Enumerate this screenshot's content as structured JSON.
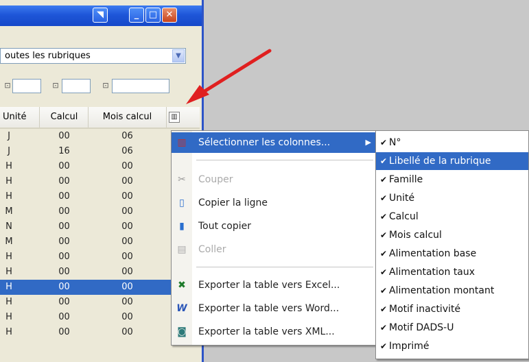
{
  "filter": {
    "value": "outes les rubriques"
  },
  "grid": {
    "headers": [
      "Unité",
      "Calcul",
      "Mois calcul"
    ],
    "rows": [
      [
        "J",
        "00",
        "06"
      ],
      [
        "J",
        "16",
        "06"
      ],
      [
        "H",
        "00",
        "00"
      ],
      [
        "H",
        "00",
        "00"
      ],
      [
        "H",
        "00",
        "00"
      ],
      [
        "M",
        "00",
        "00"
      ],
      [
        "N",
        "00",
        "00"
      ],
      [
        "M",
        "00",
        "00"
      ],
      [
        "H",
        "00",
        "00"
      ],
      [
        "H",
        "00",
        "00"
      ],
      [
        "H",
        "00",
        "00"
      ],
      [
        "H",
        "00",
        "00"
      ],
      [
        "H",
        "00",
        "00"
      ],
      [
        "H",
        "00",
        "00"
      ]
    ],
    "selected_row_index": 10
  },
  "context_menu": {
    "items": [
      {
        "label": "Sélectionner les colonnes...",
        "icon": "columns-icon",
        "enabled": true,
        "submenu": true
      },
      {
        "label": "Couper",
        "icon": "scissors-icon",
        "enabled": false
      },
      {
        "label": "Copier la ligne",
        "icon": "copy-row-icon",
        "enabled": true
      },
      {
        "label": "Tout copier",
        "icon": "copy-all-icon",
        "enabled": true
      },
      {
        "label": "Coller",
        "icon": "paste-icon",
        "enabled": false
      },
      {
        "label": "Exporter la table vers Excel...",
        "icon": "excel-icon",
        "enabled": true
      },
      {
        "label": "Exporter la table vers Word...",
        "icon": "word-icon",
        "enabled": true
      },
      {
        "label": "Exporter la table vers XML...",
        "icon": "xml-icon",
        "enabled": true
      }
    ]
  },
  "columns_submenu": {
    "items": [
      {
        "label": "N°",
        "checked": true
      },
      {
        "label": "Libellé de la rubrique",
        "checked": true
      },
      {
        "label": "Famille",
        "checked": true
      },
      {
        "label": "Unité",
        "checked": true
      },
      {
        "label": "Calcul",
        "checked": true
      },
      {
        "label": "Mois calcul",
        "checked": true
      },
      {
        "label": "Alimentation base",
        "checked": true
      },
      {
        "label": "Alimentation taux",
        "checked": true
      },
      {
        "label": "Alimentation montant",
        "checked": true
      },
      {
        "label": "Motif inactivité",
        "checked": true
      },
      {
        "label": "Motif DADS-U",
        "checked": true
      },
      {
        "label": "Imprimé",
        "checked": true
      }
    ],
    "highlighted_index": 1
  },
  "colors": {
    "selection": "#316ac5",
    "title_bar": "#1e56d8",
    "arrow": "#e02020"
  }
}
